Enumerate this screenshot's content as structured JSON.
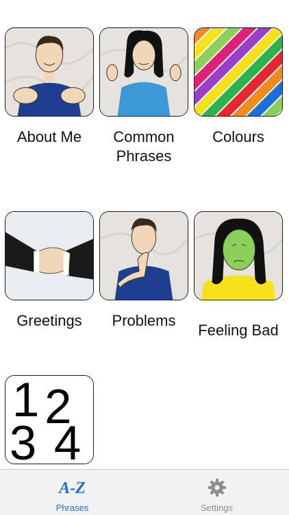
{
  "categories": [
    {
      "label": "About Me"
    },
    {
      "label": "Common\nPhrases"
    },
    {
      "label": "Colours"
    },
    {
      "label": "Greetings"
    },
    {
      "label": "Problems"
    },
    {
      "label": "Feeling Bad"
    },
    {
      "label": ""
    }
  ],
  "numbers_tile": {
    "digits": [
      "1",
      "2",
      "3",
      "4"
    ]
  },
  "tabbar": {
    "phrases": {
      "icon_text": "A-Z",
      "label": "Phrases"
    },
    "settings": {
      "label": "Settings"
    }
  },
  "colors": {
    "accent": "#1c6fd9",
    "inactive": "#8e8e93",
    "shirt_blue": "#1e3f8f",
    "shirt_light": "#3b9ad6",
    "green_face": "#8cd05a",
    "yellow_shirt": "#f7e21a"
  }
}
